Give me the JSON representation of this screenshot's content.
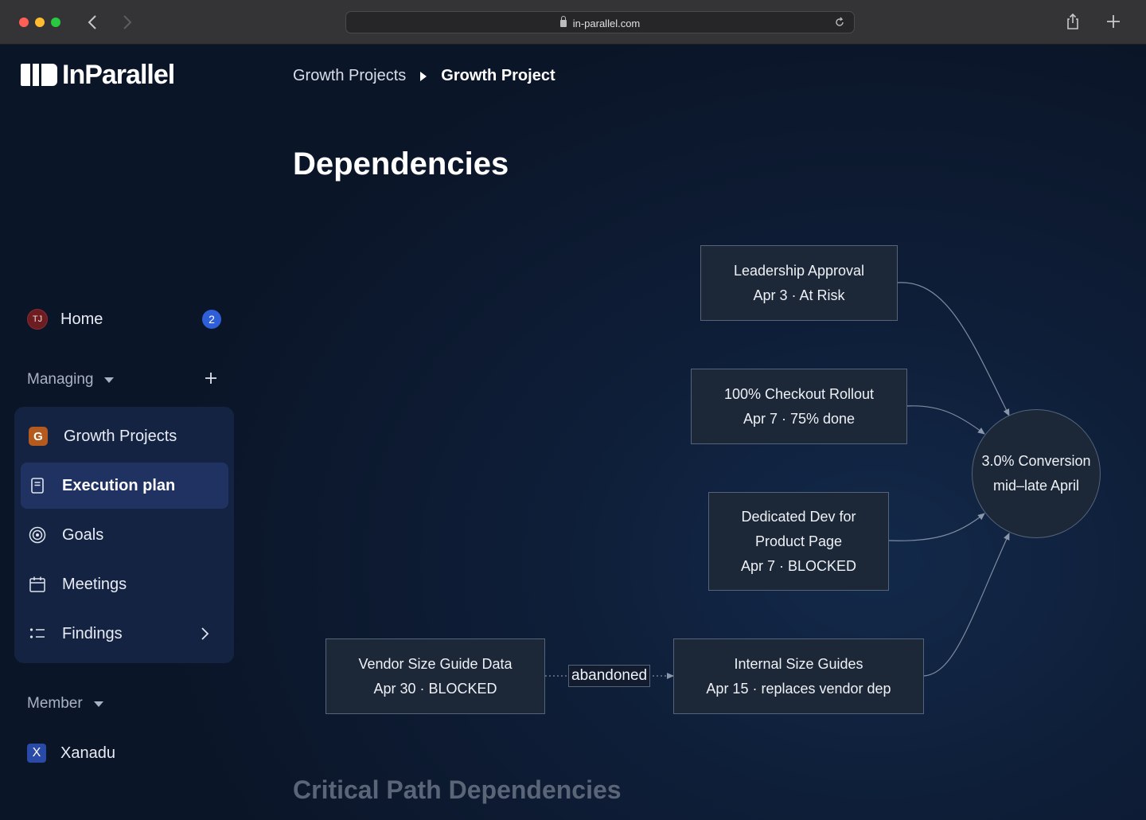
{
  "browser": {
    "url": "in-parallel.com"
  },
  "app": {
    "logo_text": "InParallel"
  },
  "breadcrumb": {
    "parent": "Growth Projects",
    "current": "Growth Project"
  },
  "page": {
    "title": "Dependencies",
    "section2_title": "Critical Path Dependencies"
  },
  "sidebar": {
    "home": {
      "avatar": "TJ",
      "label": "Home",
      "badge": "2"
    },
    "managing_label": "Managing",
    "nav_items": [
      {
        "label": "Growth Projects",
        "icon": "G"
      },
      {
        "label": "Execution plan",
        "icon": "document-icon",
        "active": true
      },
      {
        "label": "Goals",
        "icon": "target-icon"
      },
      {
        "label": "Meetings",
        "icon": "calendar-icon"
      },
      {
        "label": "Findings",
        "icon": "list-icon"
      }
    ],
    "member_label": "Member",
    "member_items": [
      {
        "label": "Xanadu",
        "icon": "X"
      }
    ]
  },
  "diagram": {
    "nodes": {
      "leadership": {
        "line1": "Leadership Approval",
        "line2": "Apr 3 · At Risk"
      },
      "checkout": {
        "line1": "100% Checkout Rollout",
        "line2": "Apr 7 · 75% done"
      },
      "dedicated": {
        "line1": "Dedicated Dev for",
        "line2": "Product Page",
        "line3": "Apr 7 · BLOCKED"
      },
      "vendor": {
        "line1": "Vendor Size Guide Data",
        "line2": "Apr 30 · BLOCKED"
      },
      "internal": {
        "line1": "Internal Size Guides",
        "line2": "Apr 15 · replaces vendor dep"
      },
      "goal": {
        "line1": "3.0% Conversion",
        "line2": "mid–late April"
      }
    },
    "edge_label": "abandoned"
  }
}
